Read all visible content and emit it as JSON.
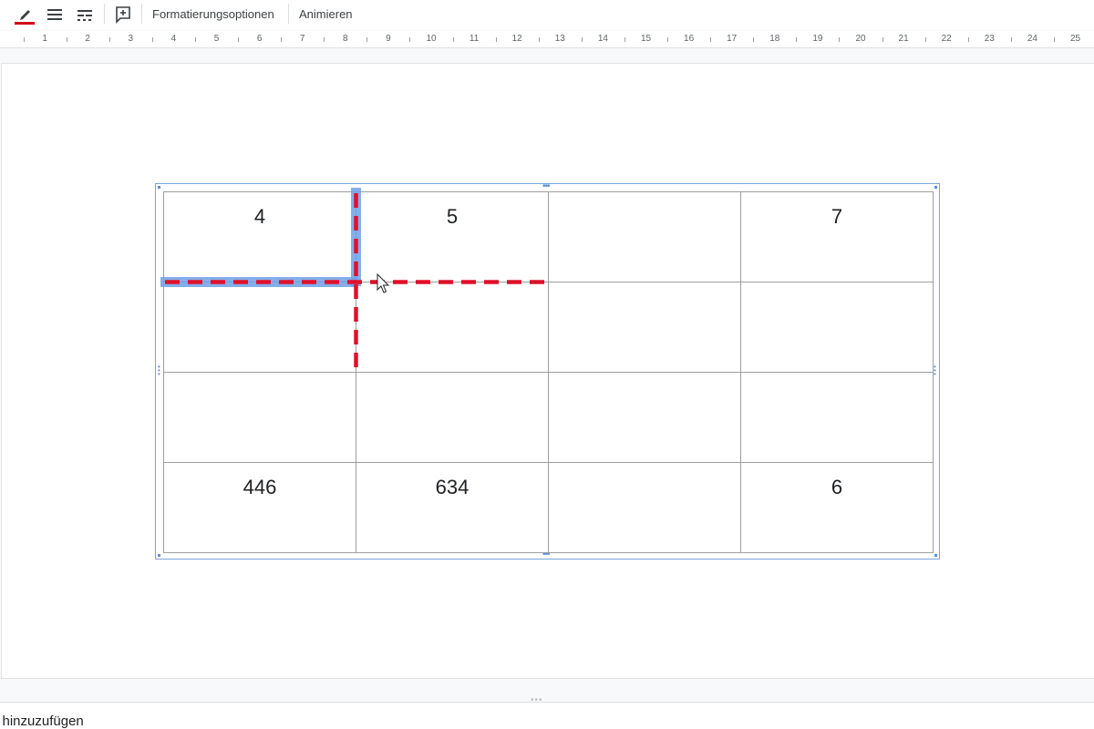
{
  "toolbar": {
    "border_color_label": "",
    "format_options_label": "Formatierungsoptionen",
    "animate_label": "Animieren",
    "border_color": "#d0021b"
  },
  "ruler": {
    "numbers": [
      "1",
      "2",
      "3",
      "4",
      "5",
      "6",
      "7",
      "8",
      "9",
      "10",
      "11",
      "12",
      "13",
      "14",
      "15",
      "16",
      "17",
      "18",
      "19",
      "20",
      "21",
      "22",
      "23",
      "24",
      "25"
    ]
  },
  "table": {
    "rows": [
      [
        "4",
        "5",
        "",
        "7"
      ],
      [
        "",
        "",
        "",
        ""
      ],
      [
        "",
        "",
        "",
        ""
      ],
      [
        "446",
        "634",
        "",
        "6"
      ]
    ]
  },
  "notes": {
    "placeholder": "n hinzuzufügen"
  },
  "colors": {
    "selection_blue": "#7aa5de",
    "dash_red": "#e0102a",
    "highlight_blue": "#6fa0e8"
  }
}
